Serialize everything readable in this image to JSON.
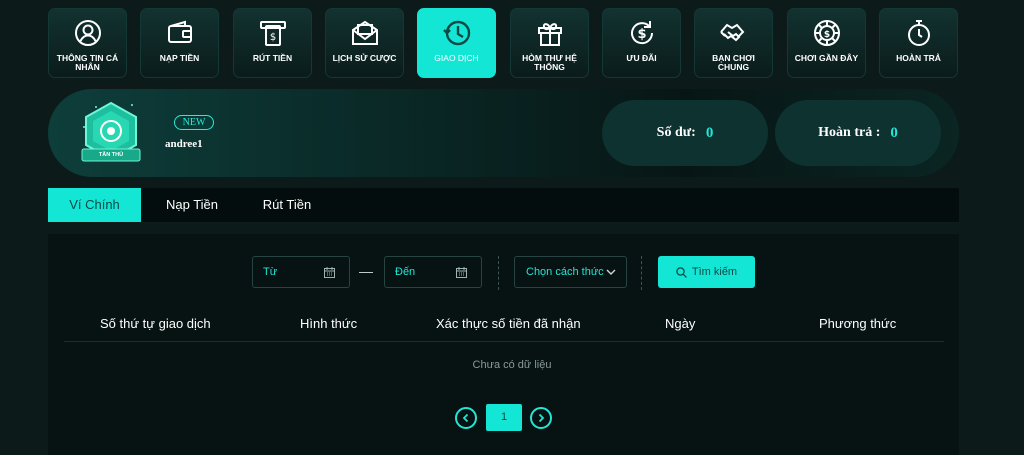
{
  "nav": [
    {
      "label": "THÔNG TIN CÁ NHÂN",
      "icon": "user-circle-icon",
      "active": false
    },
    {
      "label": "NẠP TIỀN",
      "icon": "wallet-icon",
      "active": false
    },
    {
      "label": "RÚT TIỀN",
      "icon": "atm-withdraw-icon",
      "active": false
    },
    {
      "label": "LỊCH SỬ CƯỢC",
      "icon": "envelope-icon",
      "active": false
    },
    {
      "label": "GIAO DỊCH",
      "icon": "history-clock-icon",
      "active": true
    },
    {
      "label": "HÒM THƯ HỆ THỐNG",
      "icon": "gift-box-icon",
      "active": false
    },
    {
      "label": "ƯU ĐÃI",
      "icon": "refresh-dollar-icon",
      "active": false
    },
    {
      "label": "BẠN CHƠI CHUNG",
      "icon": "handshake-icon",
      "active": false
    },
    {
      "label": "CHƠI GẦN ĐÂY",
      "icon": "chip-dollar-icon",
      "active": false
    },
    {
      "label": "HOÀN TRẢ",
      "icon": "stopwatch-icon",
      "active": false
    }
  ],
  "profile": {
    "badge_label": "TÂN THỦ",
    "new_tag": "NEW",
    "username": "andree1",
    "balance_label": "Số dư:",
    "balance_value": "0",
    "refund_label": "Hoàn trả :",
    "refund_value": "0"
  },
  "tabs": [
    {
      "label": "Ví Chính",
      "active": true
    },
    {
      "label": "Nạp Tiền",
      "active": false
    },
    {
      "label": "Rút Tiền",
      "active": false
    }
  ],
  "filters": {
    "from_placeholder": "Từ",
    "to_placeholder": "Đến",
    "method_placeholder": "Chọn cách thức",
    "search_label": "Tìm kiếm"
  },
  "table": {
    "columns": [
      "Số thứ tự giao dịch",
      "Hình thức",
      "Xác thực số tiền đã nhận",
      "Ngày",
      "Phương thức"
    ],
    "empty_text": "Chưa có dữ liệu"
  },
  "pagination": {
    "current_page": "1"
  },
  "colors": {
    "accent": "#14e6d6",
    "background": "#0c1a19",
    "panel": "#071212"
  }
}
